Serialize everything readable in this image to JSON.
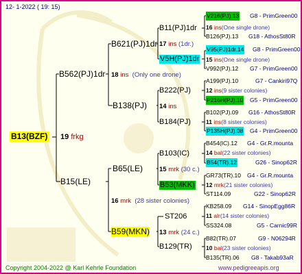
{
  "header": {
    "date": "12-  1-2022 ( 19: 15)"
  },
  "colors": {
    "border": "#d4008c",
    "background": "#fffff0",
    "highlight_yellow": "#ffff00",
    "highlight_green": "#00c000",
    "highlight_cyan": "#00e8e8",
    "line": "#000000"
  },
  "root": {
    "name": "B13(BZF)",
    "num": "19",
    "code": "frkg"
  },
  "sire": {
    "name": "B562(PJ)1dr",
    "num": "18",
    "code": "ins",
    "note": "(Only one drone)"
  },
  "dam": {
    "name": "B15(LE)",
    "num": "16",
    "code": "mrk",
    "note": "(28 sister colonies)"
  },
  "gen3": {
    "n1": {
      "name": "B621(PJ)1dr",
      "num": "17",
      "code": "ins",
      "note": "(1dr.)"
    },
    "n2": {
      "name": "B138(PJ)",
      "num": "14",
      "code": "ins"
    },
    "n3": {
      "name": "B65(LE)",
      "num": "15",
      "code": "mrk",
      "note": "(30 c.)"
    },
    "n4": {
      "name": "B59(MKN)",
      "num": "13",
      "code": "mrk",
      "note": "(24 c.)"
    }
  },
  "gen4": {
    "a": {
      "name": "B11(PJ)1dr"
    },
    "b": {
      "name": "V5H(PJ)1dr"
    },
    "c": {
      "name": "B222(PJ)"
    },
    "d": {
      "name": "B184(PJ)"
    },
    "e": {
      "name": "B103(IC)"
    },
    "f": {
      "name": "B53(MKK)"
    },
    "g": {
      "name": "ST206"
    },
    "h": {
      "name": "B129(TR)"
    }
  },
  "gen5": [
    {
      "row1_name": "V216(PJ).13",
      "row1_ref": "G8 - PrimGreen00",
      "num": "16",
      "code": "ins",
      "note": "(One single drone)",
      "row3_name": "B126(PJ).13",
      "row3_ref": "G18 - AthosSt80R"
    },
    {
      "row1_name": "V95(PJ)1dr.14",
      "row1_ref": "G8 - PrimGreen00",
      "num": "15",
      "code": "ins",
      "note": "(One single drone)",
      "row3_name": "V992(PJ).12",
      "row3_ref": "G7 - PrimGreen00"
    },
    {
      "row1_name": "A199(PJ).10",
      "row1_ref": "G7 - Cankiri97Q",
      "num": "12",
      "code": "ins",
      "note": "(9 sister colonies)",
      "row3_name": "P216H(PJ).10",
      "row3_ref": "G5 - PrimGreen00"
    },
    {
      "row1_name": "B102(PJ).09",
      "row1_ref": "G16 - AthosSt80R",
      "num": "11",
      "code": "ins",
      "note": "(8 sister colonies)",
      "row3_name": "P135H(PJ).08",
      "row3_ref": "G4 - PrimGreen00"
    },
    {
      "row1_name": "B454(IC).12",
      "row1_ref": "G4 - Gr.R.mounta",
      "num": "14",
      "code": "bal",
      "note": "(22 sister colonies)",
      "row3_name": "B54(TR).12",
      "row3_ref": "G26 - Sinop62R"
    },
    {
      "row1_name": "GR73(TR).10",
      "row1_ref": "G4 - Gr.R.mounta",
      "num": "12",
      "code": "mrk",
      "note": "(21 sister colonies)",
      "row3_name": "ST114.09",
      "row3_ref": "G22 - Sinop62R"
    },
    {
      "row1_name": "KB258.09",
      "row1_ref": "G14 - SinopEgg86R",
      "num": "11",
      "code": "alr",
      "note": "(14 sister colonies)",
      "row3_name": "SS324.08",
      "row3_ref": "G5 - Carnic99R"
    },
    {
      "row1_name": "B82(TR).07",
      "row1_ref": "G9 - N06294R",
      "num": "10",
      "code": "bal",
      "note": "(23 sister colonies)",
      "row3_name": "B135(TR).06",
      "row3_ref": "G8 - Takab93aR"
    }
  ],
  "footer": {
    "copyright": "Copyright 2004-2022 @ Karl Kehrle Foundation",
    "site": "www.pedigreeapis.org"
  }
}
